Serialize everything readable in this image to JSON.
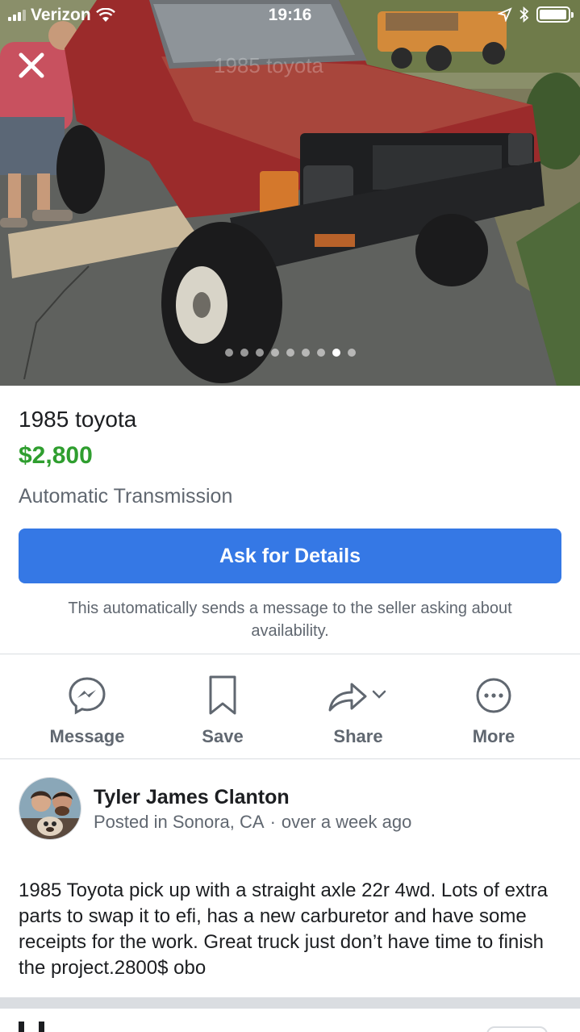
{
  "status_bar": {
    "carrier": "Verizon",
    "time": "19:16"
  },
  "gallery": {
    "photo_count": 9,
    "active_index": 7,
    "photo_watermark": "1985 toyota"
  },
  "listing": {
    "title": "1985 toyota",
    "price": "$2,800",
    "subtitle": "Automatic Transmission"
  },
  "cta": {
    "ask_label": "Ask for Details",
    "note": "This automatically sends a message to the seller asking about availability."
  },
  "actions": {
    "message_label": "Message",
    "save_label": "Save",
    "share_label": "Share",
    "more_label": "More"
  },
  "seller": {
    "name": "Tyler James Clanton",
    "location": "Posted in Sonora, CA",
    "separator": "·",
    "posted": "over a week ago"
  },
  "description": "1985 Toyota pick up with a straight axle 22r 4wd. Lots of extra parts to swap it to efi, has a new carburetor and have some receipts for the work. Great truck just don’t have time to finish the project.2800$ obo",
  "colors": {
    "primary_blue": "#3578e5",
    "price_green": "#2f9e2f",
    "muted_text": "#606770",
    "divider": "#dadde1"
  }
}
